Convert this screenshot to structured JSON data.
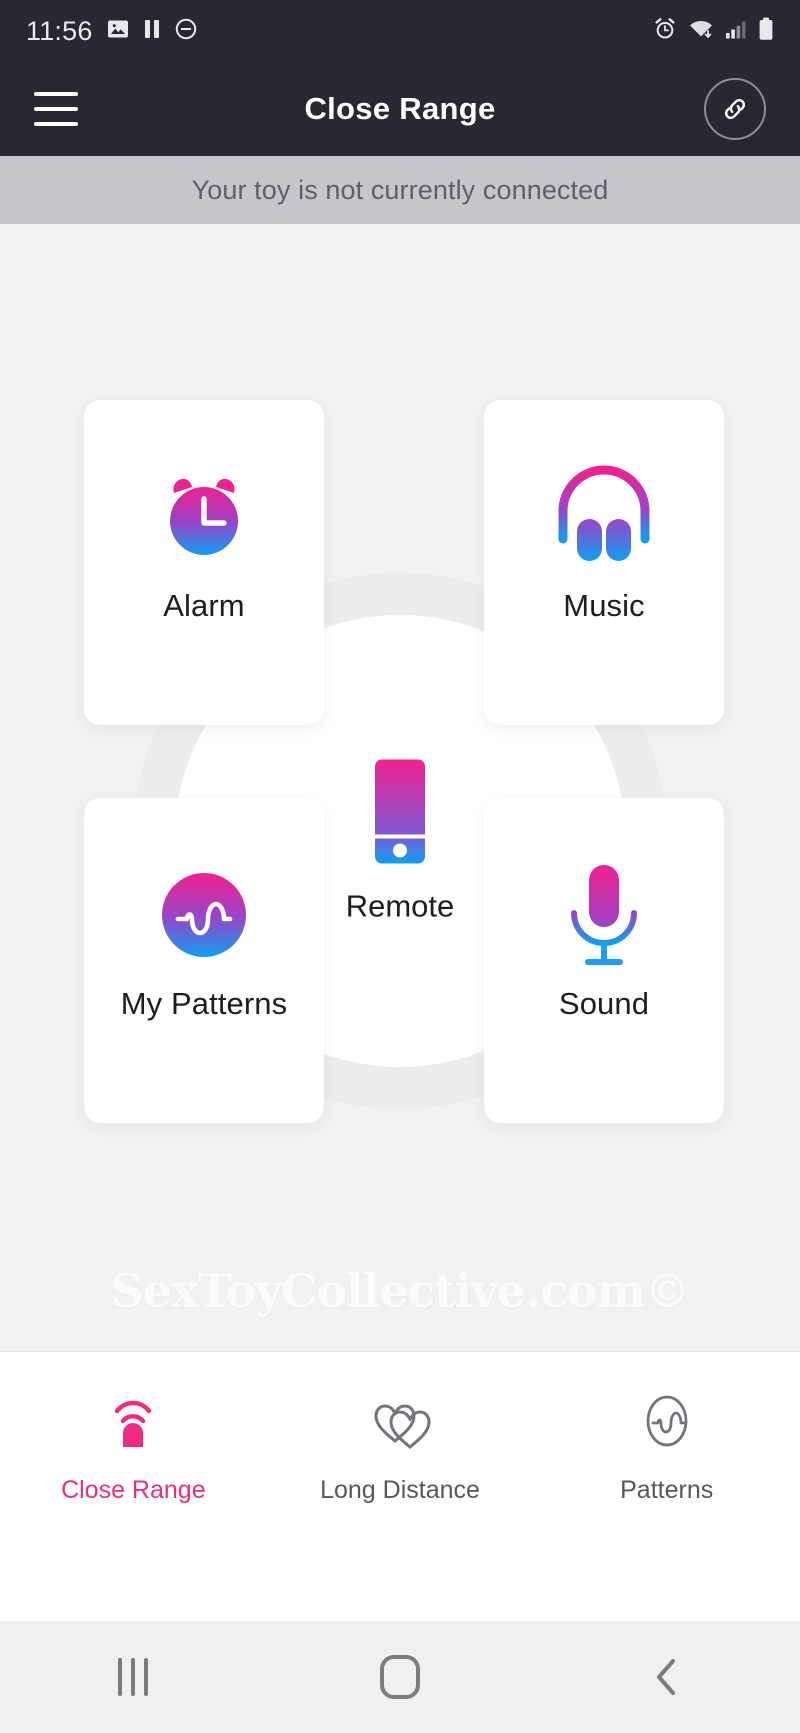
{
  "status_bar": {
    "time": "11:56",
    "left_icons": [
      "image-icon",
      "pause-icon",
      "do-not-disturb-icon"
    ],
    "right_icons": [
      "alarm-icon",
      "wifi-icon",
      "cellular-signal-icon",
      "battery-icon"
    ]
  },
  "app_bar": {
    "menu_icon": "hamburger-menu-icon",
    "title": "Close Range",
    "action_icon": "link-icon"
  },
  "banner": {
    "message": "Your toy is not currently connected"
  },
  "main": {
    "cards": [
      {
        "label": "Alarm",
        "icon": "alarm-clock-icon"
      },
      {
        "label": "Music",
        "icon": "headphones-icon"
      },
      {
        "label": "My Patterns",
        "icon": "pattern-wave-circle-icon"
      },
      {
        "label": "Sound",
        "icon": "microphone-icon"
      }
    ],
    "center": {
      "label": "Remote",
      "icon": "phone-remote-icon"
    },
    "watermark": "SexToyCollective.com©"
  },
  "tab_bar": {
    "tabs": [
      {
        "label": "Close Range",
        "icon": "toy-waves-icon",
        "active": true
      },
      {
        "label": "Long Distance",
        "icon": "two-hearts-icon",
        "active": false
      },
      {
        "label": "Patterns",
        "icon": "wave-oval-icon",
        "active": false
      }
    ]
  },
  "system_nav": {
    "recents_label": "recents-icon",
    "home_label": "home-icon",
    "back_label": "back-icon"
  },
  "colors": {
    "header_bg": "#272832",
    "banner_bg": "#c6c7cc",
    "page_bg": "#f2f2f2",
    "card_bg": "#ffffff",
    "accent_pink": "#ef2b81",
    "accent_blue": "#0d9ff2",
    "accent_purple": "#8b4fc4",
    "text_primary": "#1d1d22",
    "text_muted": "#56575f"
  }
}
